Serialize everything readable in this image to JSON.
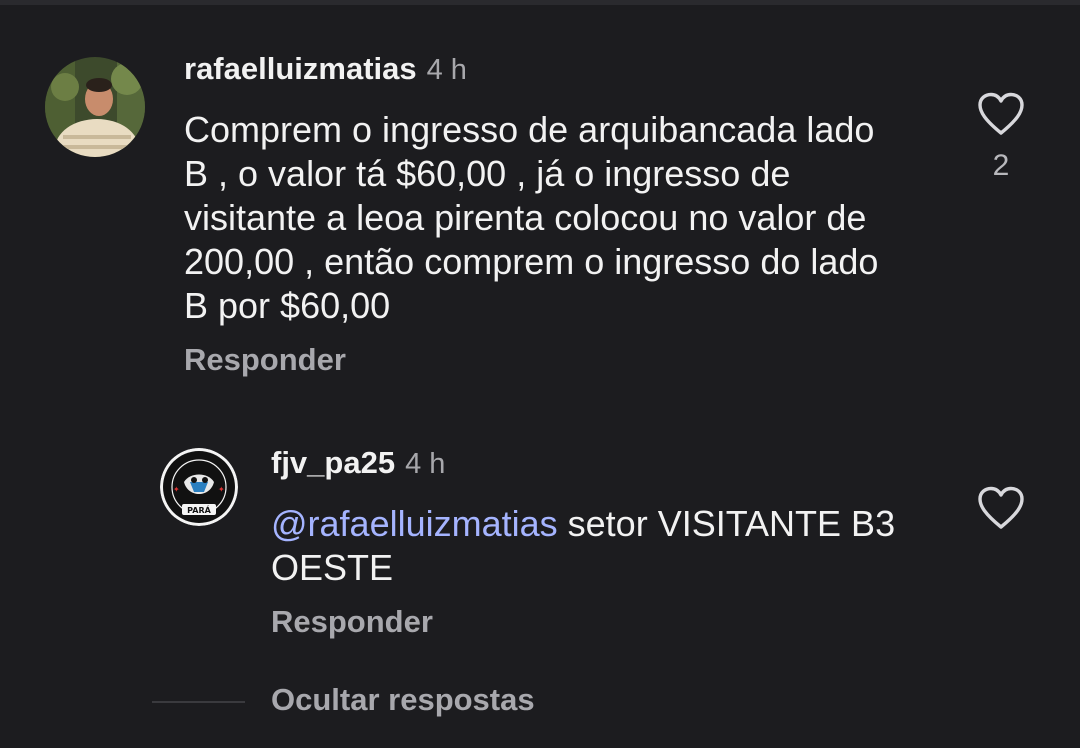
{
  "comments": [
    {
      "username": "rafaelluizmatias",
      "time": "4 h",
      "text": "Comprem o ingresso de arquibancada lado B , o valor tá $60,00 , já o ingresso de visitante a leoa pirenta colocou no valor de 200,00 , então comprem o ingresso do lado B por $60,00",
      "reply_label": "Responder",
      "likes": "2",
      "avatar_icon": "user-photo-avatar",
      "like_icon": "heart-outline-icon"
    },
    {
      "username": "fjv_pa25",
      "time": "4 h",
      "mention": "@rafaelluizmatias",
      "text": " setor VISITANTE B3 OESTE",
      "reply_label": "Responder",
      "avatar_icon": "club-logo-avatar",
      "avatar_logo_text": "PARÁ",
      "like_icon": "heart-outline-icon"
    }
  ],
  "hide_replies_label": "Ocultar respostas",
  "colors": {
    "background": "#1c1c1f",
    "text": "#f2f2f2",
    "muted": "#a8a8ad",
    "mention": "#a5b4ff"
  }
}
